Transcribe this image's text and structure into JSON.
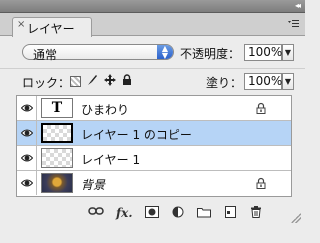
{
  "panel": {
    "tab_label": "レイヤー",
    "tab_close": "×",
    "menu_icon": "panel-menu-icon",
    "collapse_icon": "collapse-icon"
  },
  "blend": {
    "mode": "通常",
    "opacity_label": "不透明度：",
    "opacity_value": "100%"
  },
  "lock": {
    "label": "ロック：",
    "fill_label": "塗り：",
    "fill_value": "100%"
  },
  "layers": [
    {
      "name": "ひまわり",
      "thumb": "T",
      "kind": "text",
      "selected": false,
      "locked": true
    },
    {
      "name": "レイヤー 1 のコピー",
      "kind": "pixel",
      "selected": true,
      "locked": false
    },
    {
      "name": "レイヤー 1",
      "kind": "pixel",
      "selected": false,
      "locked": false
    },
    {
      "name": "背景",
      "kind": "background",
      "selected": false,
      "locked": true
    }
  ],
  "footer_icons": [
    "link-icon",
    "fx-icon",
    "mask-icon",
    "adjustment-icon",
    "folder-icon",
    "new-layer-icon",
    "trash-icon"
  ],
  "colors": {
    "selected_row": "#b6d4f6",
    "select_arrows": "#2c62cc"
  }
}
